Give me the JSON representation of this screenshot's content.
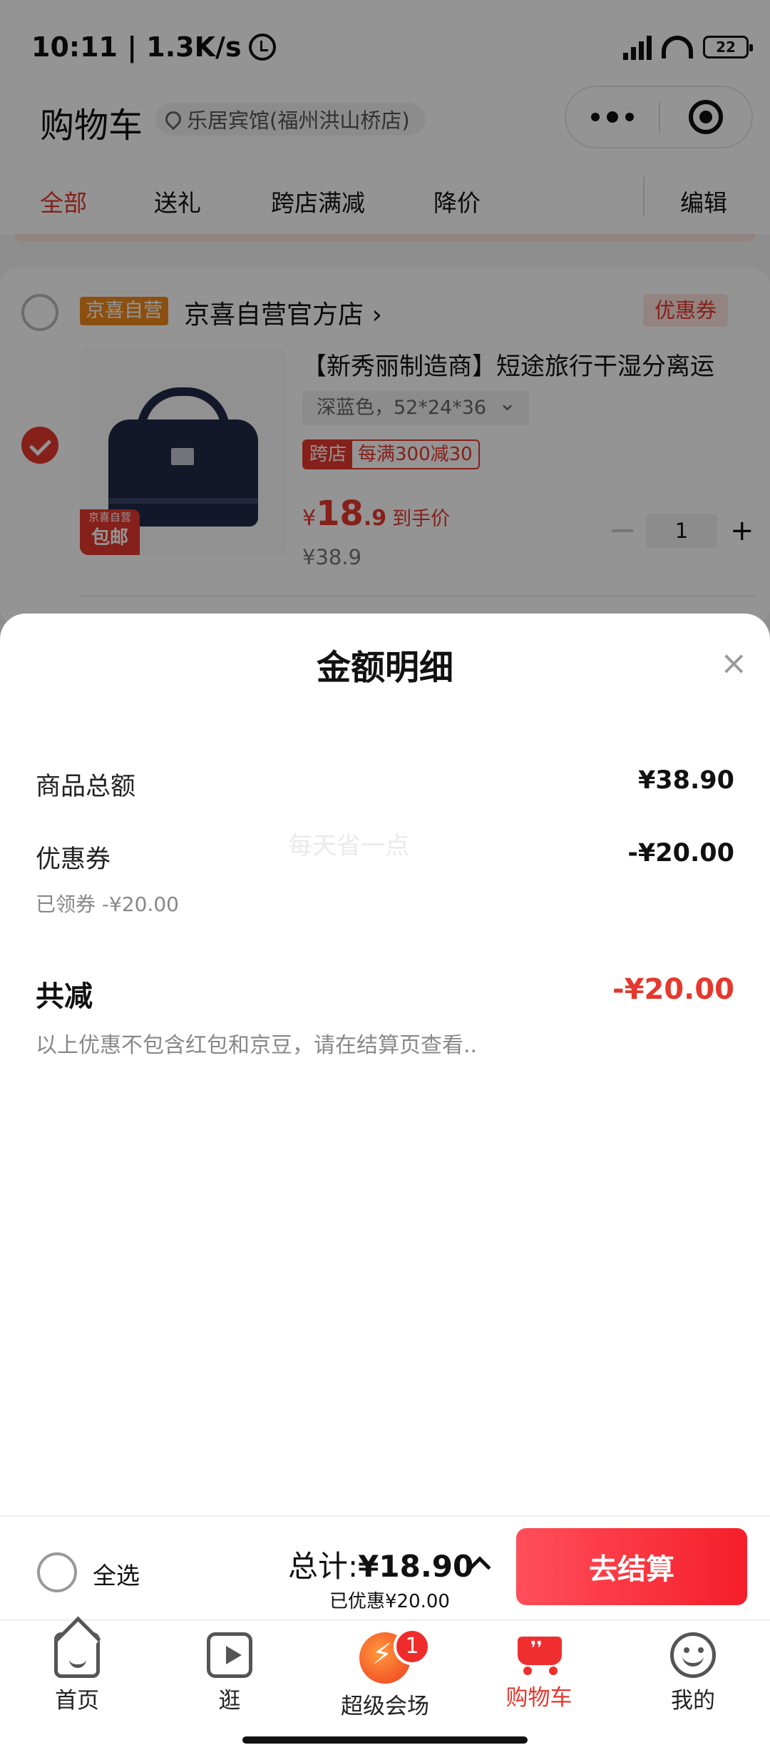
{
  "status_bar": {
    "time": "10:11 | 1.3K/s",
    "battery": "22"
  },
  "header": {
    "title": "购物车",
    "location": "乐居宾馆(福州洪山桥店)"
  },
  "tabs": [
    {
      "label": "全部",
      "active": true
    },
    {
      "label": "送礼"
    },
    {
      "label": "跨店满减"
    },
    {
      "label": "降价"
    },
    {
      "label": "编辑"
    }
  ],
  "shop": {
    "self_tag": "京喜自营",
    "name": "京喜自营官方店 ›",
    "coupon_label": "优惠券"
  },
  "product": {
    "badge_top": "京喜自营",
    "badge_bottom": "包邮",
    "title": "【新秀丽制造商】短途旅行干湿分离运",
    "sku": "深蓝色，52*24*36",
    "promo_tag": "跨店",
    "promo_text": "每满300减30",
    "price_currency": "¥",
    "price_int": "18",
    "price_dec": ".9",
    "price_hint": "到手价",
    "old_price": "¥38.9",
    "quantity": "1"
  },
  "sheet": {
    "title": "金额明细",
    "close": "×",
    "watermark": "每天省一点",
    "goods_total_label": "商品总额",
    "goods_total_value": "¥38.90",
    "coupon_label": "优惠券",
    "coupon_value": "-¥20.00",
    "coupon_sub": "已领券 -¥20.00",
    "total_discount_label": "共减",
    "total_discount_value": "-¥20.00",
    "note": "以上优惠不包含红包和京豆，请在结算页查看.."
  },
  "checkout": {
    "select_all": "全选",
    "total_label": "总计:",
    "total_amount": "¥18.90",
    "saved": "已优惠¥20.00",
    "button": "去结算"
  },
  "nav": [
    {
      "label": "首页",
      "icon": "home-icon"
    },
    {
      "label": "逛",
      "icon": "video-play-icon"
    },
    {
      "label": "超级会场",
      "icon": "super-venue-icon",
      "badge": "1"
    },
    {
      "label": "购物车",
      "icon": "cart-icon",
      "active": true
    },
    {
      "label": "我的",
      "icon": "smiley-icon"
    }
  ],
  "colors": {
    "accent": "#e5382e",
    "self_tag": "#f08a1c",
    "checkout": "#f51e2a"
  }
}
